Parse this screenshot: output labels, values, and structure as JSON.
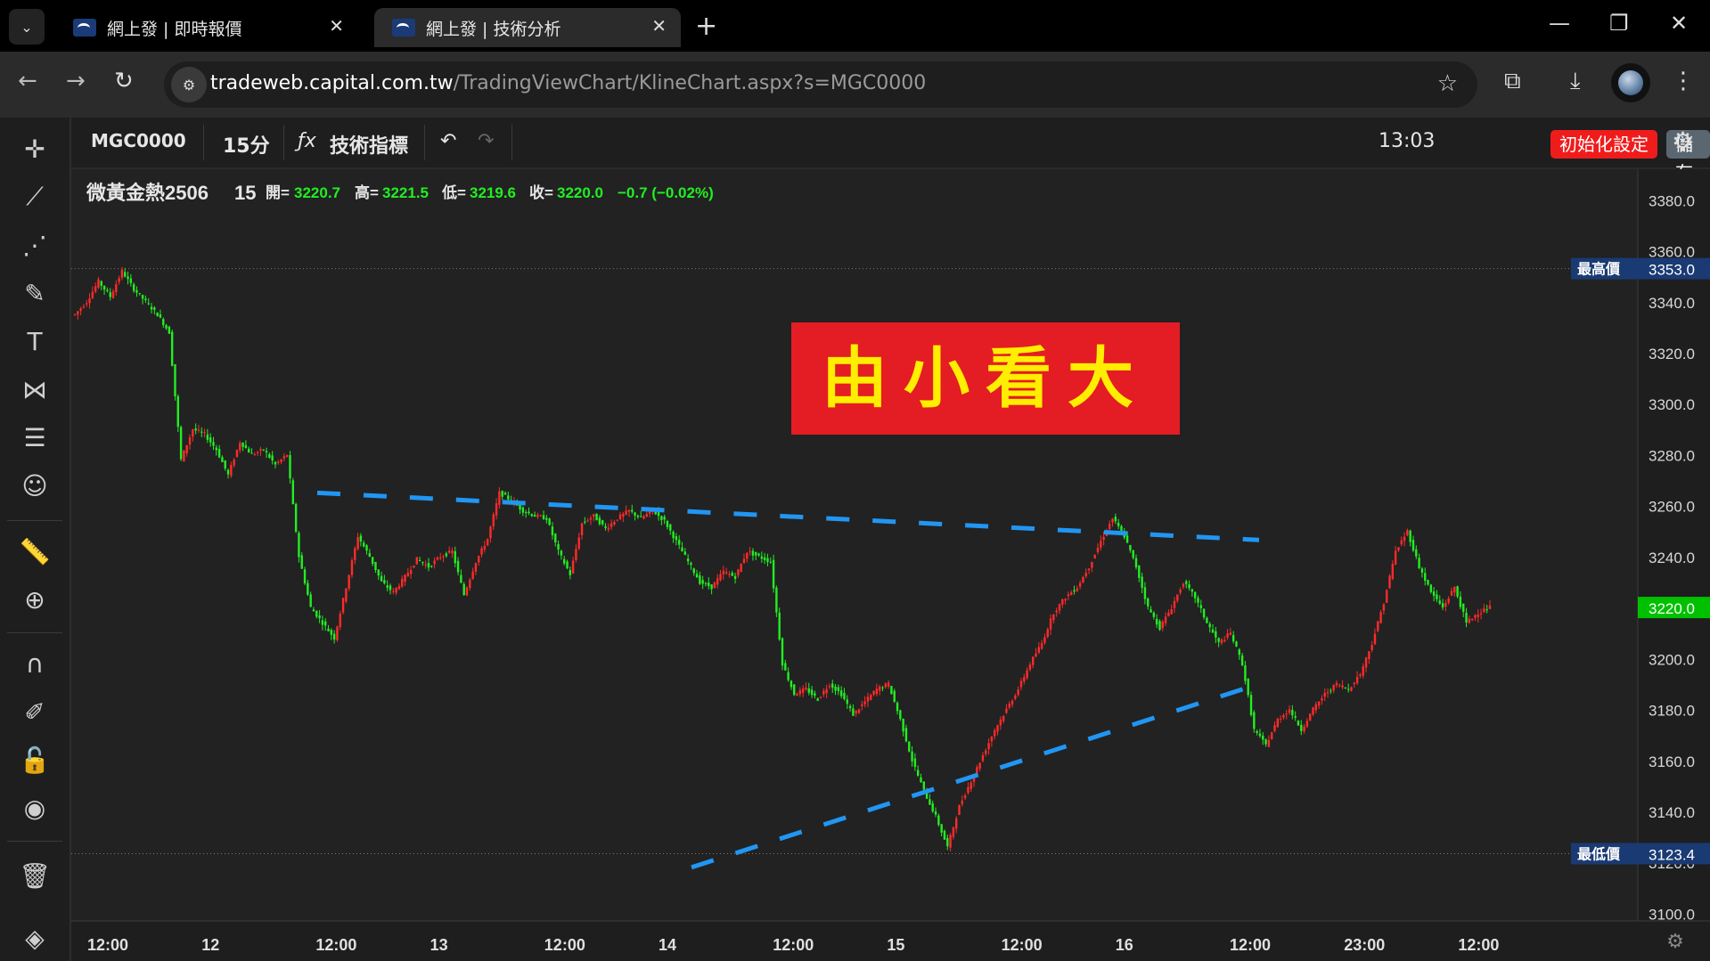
{
  "browser": {
    "tabs": [
      {
        "title": "網上發 | 即時報價",
        "close": "✕"
      },
      {
        "title": "網上發 | 技術分析",
        "close": "✕"
      }
    ],
    "new_tab": "+",
    "window_controls": {
      "minimize": "—",
      "restore": "❐",
      "close": "✕"
    },
    "url_host": "tradeweb.capital.com.tw",
    "url_path": "/TradingViewChart/KlineChart.aspx?s=MGC0000"
  },
  "toolbar": {
    "symbol": "MGC0000",
    "interval": "15分",
    "indicators_icon": "ƒx",
    "indicators_label": "技術指標",
    "time": "13:03",
    "reset_label": "初始化設定",
    "save_label": "儲存"
  },
  "legend": {
    "name": "微黃金熱2506",
    "interval": "15",
    "open_label": "開=",
    "open": "3220.7",
    "high_label": "高=",
    "high": "3221.5",
    "low_label": "低=",
    "low": "3219.6",
    "close_label": "收=",
    "close": "3220.0",
    "change": "−0.7 (−0.02%)"
  },
  "banner": {
    "text": "由小看大",
    "bg": "#e31d23",
    "color": "#ffee00"
  },
  "colors": {
    "up": "#ff2a2a",
    "down": "#22ee22",
    "trendline": "#2196f3",
    "price_label": "#00c000",
    "level_label": "#1a3a73"
  },
  "chart_data": {
    "type": "candlestick",
    "title": "微黃金熱2506",
    "interval": "15",
    "y_axis": {
      "ticks": [
        3100,
        3120,
        3140,
        3160,
        3180,
        3200,
        3220,
        3240,
        3260,
        3280,
        3300,
        3320,
        3340,
        3360,
        3380
      ],
      "tick_labels": [
        "3100.0",
        "3120.0",
        "3140.0",
        "3160.0",
        "3180.0",
        "3200.0",
        "3220.0",
        "3240.0",
        "3260.0",
        "3280.0",
        "3300.0",
        "3320.0",
        "3340.0",
        "3360.0",
        "3380.0"
      ],
      "range": [
        3097,
        3392
      ]
    },
    "x_axis": {
      "tick_labels": [
        "12:00",
        "12",
        "12:00",
        "13",
        "12:00",
        "14",
        "12:00",
        "15",
        "12:00",
        "16",
        "12:00",
        "23:00",
        "12:00"
      ]
    },
    "current_price": {
      "value": 3220.0,
      "label": "3220.0"
    },
    "max_line": {
      "label": "最高價",
      "value": 3353.0,
      "value_label": "3353.0"
    },
    "min_line": {
      "label": "最低價",
      "value": 3123.4,
      "value_label": "3123.4"
    },
    "price_path": [
      [
        0,
        3335
      ],
      [
        1,
        3340
      ],
      [
        2,
        3348
      ],
      [
        3,
        3342
      ],
      [
        4,
        3352
      ],
      [
        5,
        3345
      ],
      [
        6,
        3340
      ],
      [
        7,
        3335
      ],
      [
        8,
        3328
      ],
      [
        9,
        3278
      ],
      [
        10,
        3290
      ],
      [
        11,
        3288
      ],
      [
        12,
        3282
      ],
      [
        13,
        3272
      ],
      [
        14,
        3285
      ],
      [
        15,
        3280
      ],
      [
        16,
        3282
      ],
      [
        17,
        3276
      ],
      [
        18,
        3280
      ],
      [
        19,
        3240
      ],
      [
        20,
        3220
      ],
      [
        21,
        3214
      ],
      [
        22,
        3208
      ],
      [
        23,
        3228
      ],
      [
        24,
        3248
      ],
      [
        25,
        3240
      ],
      [
        26,
        3230
      ],
      [
        27,
        3226
      ],
      [
        28,
        3232
      ],
      [
        29,
        3239
      ],
      [
        30,
        3236
      ],
      [
        31,
        3240
      ],
      [
        32,
        3242
      ],
      [
        33,
        3225
      ],
      [
        34,
        3238
      ],
      [
        35,
        3247
      ],
      [
        36,
        3265
      ],
      [
        37,
        3262
      ],
      [
        38,
        3258
      ],
      [
        39,
        3256
      ],
      [
        40,
        3255
      ],
      [
        41,
        3242
      ],
      [
        42,
        3233
      ],
      [
        43,
        3253
      ],
      [
        44,
        3256
      ],
      [
        45,
        3251
      ],
      [
        46,
        3255
      ],
      [
        47,
        3258
      ],
      [
        48,
        3255
      ],
      [
        49,
        3258
      ],
      [
        50,
        3254
      ],
      [
        51,
        3246
      ],
      [
        52,
        3238
      ],
      [
        53,
        3230
      ],
      [
        54,
        3228
      ],
      [
        55,
        3234
      ],
      [
        56,
        3232
      ],
      [
        57,
        3242
      ],
      [
        58,
        3240
      ],
      [
        59,
        3238
      ],
      [
        60,
        3198
      ],
      [
        61,
        3186
      ],
      [
        62,
        3188
      ],
      [
        63,
        3184
      ],
      [
        64,
        3190
      ],
      [
        65,
        3186
      ],
      [
        66,
        3178
      ],
      [
        67,
        3183
      ],
      [
        68,
        3188
      ],
      [
        69,
        3190
      ],
      [
        70,
        3176
      ],
      [
        71,
        3160
      ],
      [
        72,
        3148
      ],
      [
        73,
        3138
      ],
      [
        74,
        3126
      ],
      [
        75,
        3142
      ],
      [
        76,
        3152
      ],
      [
        77,
        3162
      ],
      [
        78,
        3172
      ],
      [
        79,
        3180
      ],
      [
        80,
        3188
      ],
      [
        81,
        3198
      ],
      [
        82,
        3206
      ],
      [
        83,
        3218
      ],
      [
        84,
        3224
      ],
      [
        85,
        3228
      ],
      [
        86,
        3236
      ],
      [
        87,
        3246
      ],
      [
        88,
        3255
      ],
      [
        89,
        3248
      ],
      [
        90,
        3236
      ],
      [
        91,
        3220
      ],
      [
        92,
        3212
      ],
      [
        93,
        3220
      ],
      [
        94,
        3230
      ],
      [
        95,
        3224
      ],
      [
        96,
        3214
      ],
      [
        97,
        3206
      ],
      [
        98,
        3210
      ],
      [
        99,
        3198
      ],
      [
        100,
        3172
      ],
      [
        101,
        3166
      ],
      [
        102,
        3176
      ],
      [
        103,
        3180
      ],
      [
        104,
        3172
      ],
      [
        105,
        3180
      ],
      [
        106,
        3186
      ],
      [
        107,
        3190
      ],
      [
        108,
        3188
      ],
      [
        109,
        3194
      ],
      [
        110,
        3206
      ],
      [
        111,
        3222
      ],
      [
        112,
        3242
      ],
      [
        113,
        3250
      ],
      [
        114,
        3236
      ],
      [
        115,
        3226
      ],
      [
        116,
        3220
      ],
      [
        117,
        3228
      ],
      [
        118,
        3214
      ],
      [
        119,
        3218
      ],
      [
        120,
        3220
      ]
    ],
    "trendlines": [
      {
        "style": "dashed",
        "from": [
          -0.25,
          3265
        ],
        "to": [
          1.1,
          3246.5
        ]
      },
      {
        "style": "dashed",
        "from": [
          0.53,
          3118
        ],
        "to": [
          1.1,
          3190
        ]
      }
    ]
  }
}
